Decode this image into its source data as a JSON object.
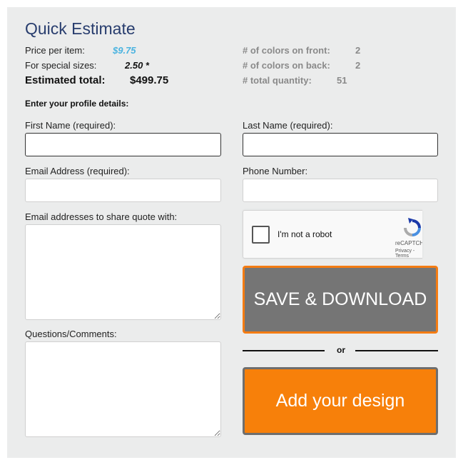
{
  "title": "Quick Estimate",
  "summary": {
    "price_label": "Price per item:",
    "price_value": "$9.75",
    "special_label": "For special sizes:",
    "special_value": "2.50 *",
    "total_label": "Estimated total:",
    "total_value": "$499.75",
    "front_label": "# of colors on front:",
    "front_value": "2",
    "back_label": "# of colors on back:",
    "back_value": "2",
    "qty_label": "# total quantity:",
    "qty_value": "51"
  },
  "profile": {
    "heading": "Enter your profile details:",
    "first_name_label": "First Name (required):",
    "first_name_value": "",
    "last_name_label": "Last Name (required):",
    "last_name_value": "",
    "email_label": "Email Address (required):",
    "email_value": "",
    "phone_label": "Phone Number:",
    "phone_value": "",
    "share_label": "Email addresses to share quote with:",
    "share_value": "",
    "comments_label": "Questions/Comments:",
    "comments_value": ""
  },
  "recaptcha": {
    "checkbox_label": "I'm not a robot",
    "brand": "reCAPTCHA",
    "links": "Privacy - Terms",
    "icon": "recaptcha-icon"
  },
  "actions": {
    "save_label": "SAVE & DOWNLOAD",
    "or_label": "or",
    "design_label": "Add your design"
  },
  "colors": {
    "panel_bg": "#ebecec",
    "title": "#283d6e",
    "price": "#4ab3e0",
    "save_bg": "#757575",
    "save_border": "#f47c13",
    "design_bg": "#f7800a",
    "design_border": "#6e6e6e"
  }
}
